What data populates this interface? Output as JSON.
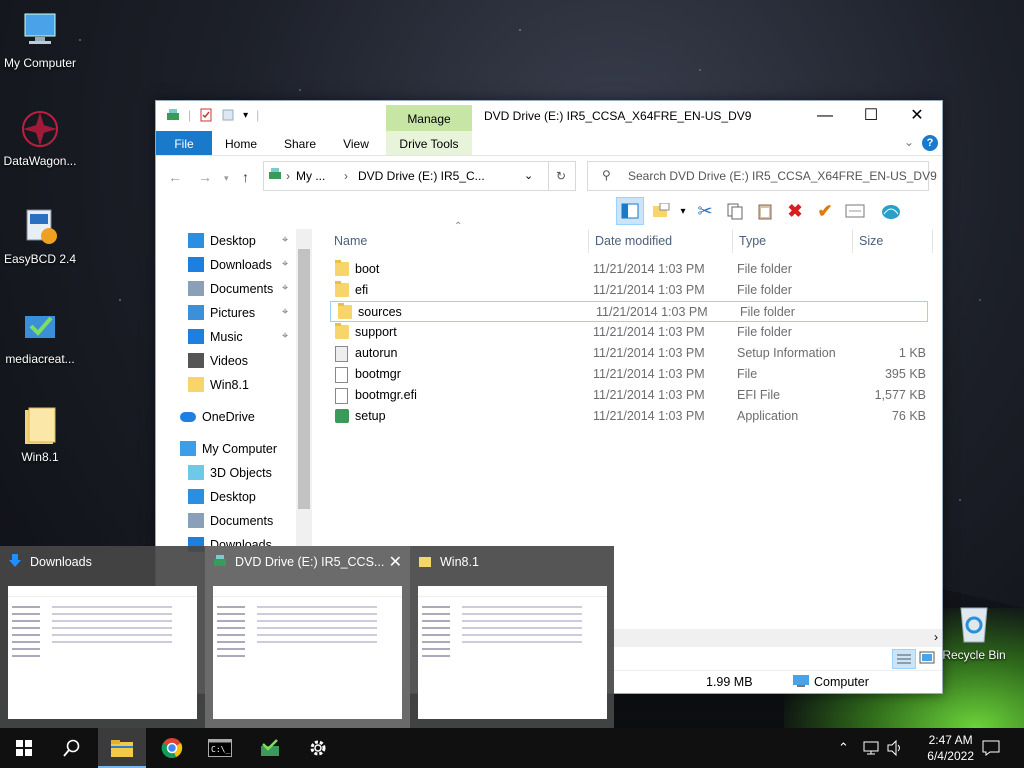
{
  "desktop": {
    "icons": [
      {
        "label": "My Computer"
      },
      {
        "label": "DataWagon..."
      },
      {
        "label": "EasyBCD 2.4"
      },
      {
        "label": "mediacreat..."
      },
      {
        "label": "Win8.1"
      },
      {
        "label": "Recycle Bin"
      }
    ]
  },
  "window": {
    "title": "DVD Drive (E:) IR5_CCSA_X64FRE_EN-US_DV9",
    "contextual_tab": "Manage",
    "tabs": [
      "File",
      "Home",
      "Share",
      "View",
      "Drive Tools"
    ],
    "address": {
      "seg1": "My ...",
      "seg2": "DVD Drive (E:) IR5_C..."
    },
    "search_placeholder": "Search DVD Drive (E:) IR5_CCSA_X64FRE_EN-US_DV9",
    "nav": [
      {
        "label": "Desktop",
        "icon": "desktop-icon",
        "pinned": true
      },
      {
        "label": "Downloads",
        "icon": "downloads-icon",
        "pinned": true
      },
      {
        "label": "Documents",
        "icon": "documents-icon",
        "pinned": true
      },
      {
        "label": "Pictures",
        "icon": "pictures-icon",
        "pinned": true
      },
      {
        "label": "Music",
        "icon": "music-icon",
        "pinned": true
      },
      {
        "label": "Videos",
        "icon": "videos-icon",
        "pinned": false
      },
      {
        "label": "Win8.1",
        "icon": "folder-icon",
        "pinned": false
      },
      {
        "label": "OneDrive",
        "icon": "onedrive-icon",
        "pinned": false
      },
      {
        "label": "My Computer",
        "icon": "computer-icon",
        "pinned": false
      },
      {
        "label": "3D Objects",
        "icon": "3d-objects-icon",
        "pinned": false
      },
      {
        "label": "Desktop",
        "icon": "desktop-icon",
        "pinned": false
      },
      {
        "label": "Documents",
        "icon": "documents-icon",
        "pinned": false
      },
      {
        "label": "Downloads",
        "icon": "downloads-icon",
        "pinned": false
      }
    ],
    "columns": [
      "Name",
      "Date modified",
      "Type",
      "Size"
    ],
    "files": [
      {
        "name": "boot",
        "date": "11/21/2014 1:03 PM",
        "type": "File folder",
        "size": "",
        "icon": "folder-icon"
      },
      {
        "name": "efi",
        "date": "11/21/2014 1:03 PM",
        "type": "File folder",
        "size": "",
        "icon": "folder-icon"
      },
      {
        "name": "sources",
        "date": "11/21/2014 1:03 PM",
        "type": "File folder",
        "size": "",
        "icon": "folder-icon",
        "selected": true
      },
      {
        "name": "support",
        "date": "11/21/2014 1:03 PM",
        "type": "File folder",
        "size": "",
        "icon": "folder-icon"
      },
      {
        "name": "autorun",
        "date": "11/21/2014 1:03 PM",
        "type": "Setup Information",
        "size": "1 KB",
        "icon": "setup-info-icon"
      },
      {
        "name": "bootmgr",
        "date": "11/21/2014 1:03 PM",
        "type": "File",
        "size": "395 KB",
        "icon": "file-icon"
      },
      {
        "name": "bootmgr.efi",
        "date": "11/21/2014 1:03 PM",
        "type": "EFI File",
        "size": "1,577 KB",
        "icon": "file-icon"
      },
      {
        "name": "setup",
        "date": "11/21/2014 1:03 PM",
        "type": "Application",
        "size": "76 KB",
        "icon": "setup-app-icon"
      }
    ],
    "status": {
      "size": "1.99 MB",
      "location": "Computer"
    }
  },
  "previews": [
    {
      "title": "Downloads"
    },
    {
      "title": "DVD Drive (E:) IR5_CCS..."
    },
    {
      "title": "Win8.1"
    }
  ],
  "taskbar": {
    "time": "2:47 AM",
    "date": "6/4/2022"
  },
  "colors": {
    "accent": "#1979ca",
    "manage": "#c7e6a6",
    "selection": "#99d1ff"
  }
}
